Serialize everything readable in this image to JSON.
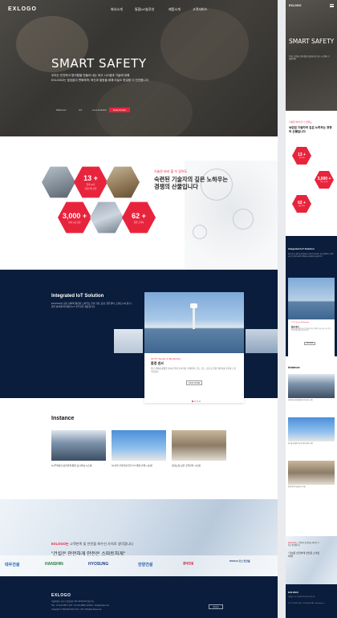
{
  "brand": {
    "logo": "EXLOGO",
    "accent": "#e8243d",
    "navy": "#0b1d3c"
  },
  "nav": [
    "회사소개",
    "통합IoT솔루션",
    "제품소개",
    "고객서비스"
  ],
  "hero": {
    "title": "SMART SAFETY",
    "sub1": "우리는 안전하고 편리함을 만들어 내는 최고 시스템과 기술에 대해",
    "sub2": "EXLOGO는 끊임없이 변화하며, 혁신과 열정을 위해 오늘도 한걸음 더 전진합니다",
    "tabs": [
      "Welcome",
      "IoT",
      "Loss Solution",
      "Data Center"
    ]
  },
  "about": {
    "kicker": "기술은 바라 할 수 있어도",
    "title": "숙련된 기술자의 깊은 노하우는 경쟁의 산물입니다",
    "stats": [
      {
        "value": "13 +",
        "label1": "업력 10년",
        "label2": "전문인력 보유"
      },
      {
        "value": "3,000 +",
        "label1": "설치 시공 횟수",
        "label2": ""
      },
      {
        "value": "62 +",
        "label1": "협업 고객사",
        "label2": ""
      }
    ]
  },
  "iot": {
    "title": "Integrated IoT Solution",
    "desc": "EXLOGO는 첨단 장비와 통합된 노하우로 건설 현장, 공장, 물류센터, 스마트시티 등 다양한 분야에 최적화된 IoT 솔루션을 제공합니다.",
    "card": {
      "kicker": "CCTV, Sensor & Monitoring",
      "title": "환경 센서",
      "desc": "첨단 센서를 활용한 실시간 환경 모니터링. 미세먼지, 온도, 습도, 소음 등 현장 데이터를 수집하고 분석합니다.",
      "button": "VIEW MORE"
    }
  },
  "instance": {
    "title": "Instance",
    "items": [
      {
        "caption": "LH주택공사 보안관제 통합 모니터링 시스템"
      },
      {
        "caption": "SL건설 신설현장 안전 IoT 통합 관제 시스템"
      },
      {
        "caption": "정남도청 보안 출입관리 시스템"
      }
    ]
  },
  "partners": {
    "line1_accent": "EXLOGO는",
    "line1_rest": " 고객만족 및 안전을 최우선 가치로 생각합니다",
    "line2": "\"건설은 안전하게 안전은 스마트하게\"",
    "logos": [
      "대우건설",
      "HANSHIN",
      "HYOSUNG",
      "한양건설",
      "롯데건설",
      "POSCO 포스코건설"
    ]
  },
  "footer": {
    "logo": "EXLOGO",
    "addr": "서울특별시 서초구 강남대로 123, EXLOGO 빌딩 4층",
    "tel": "TEL : 02-123-4567 | FAX : 02-123-4568 | E-MAIL : info@exlogo.com",
    "copy": "Copyright © 2020 EXLOGO CO., LTD. All Rights Reserved.",
    "button": "개인정보"
  }
}
